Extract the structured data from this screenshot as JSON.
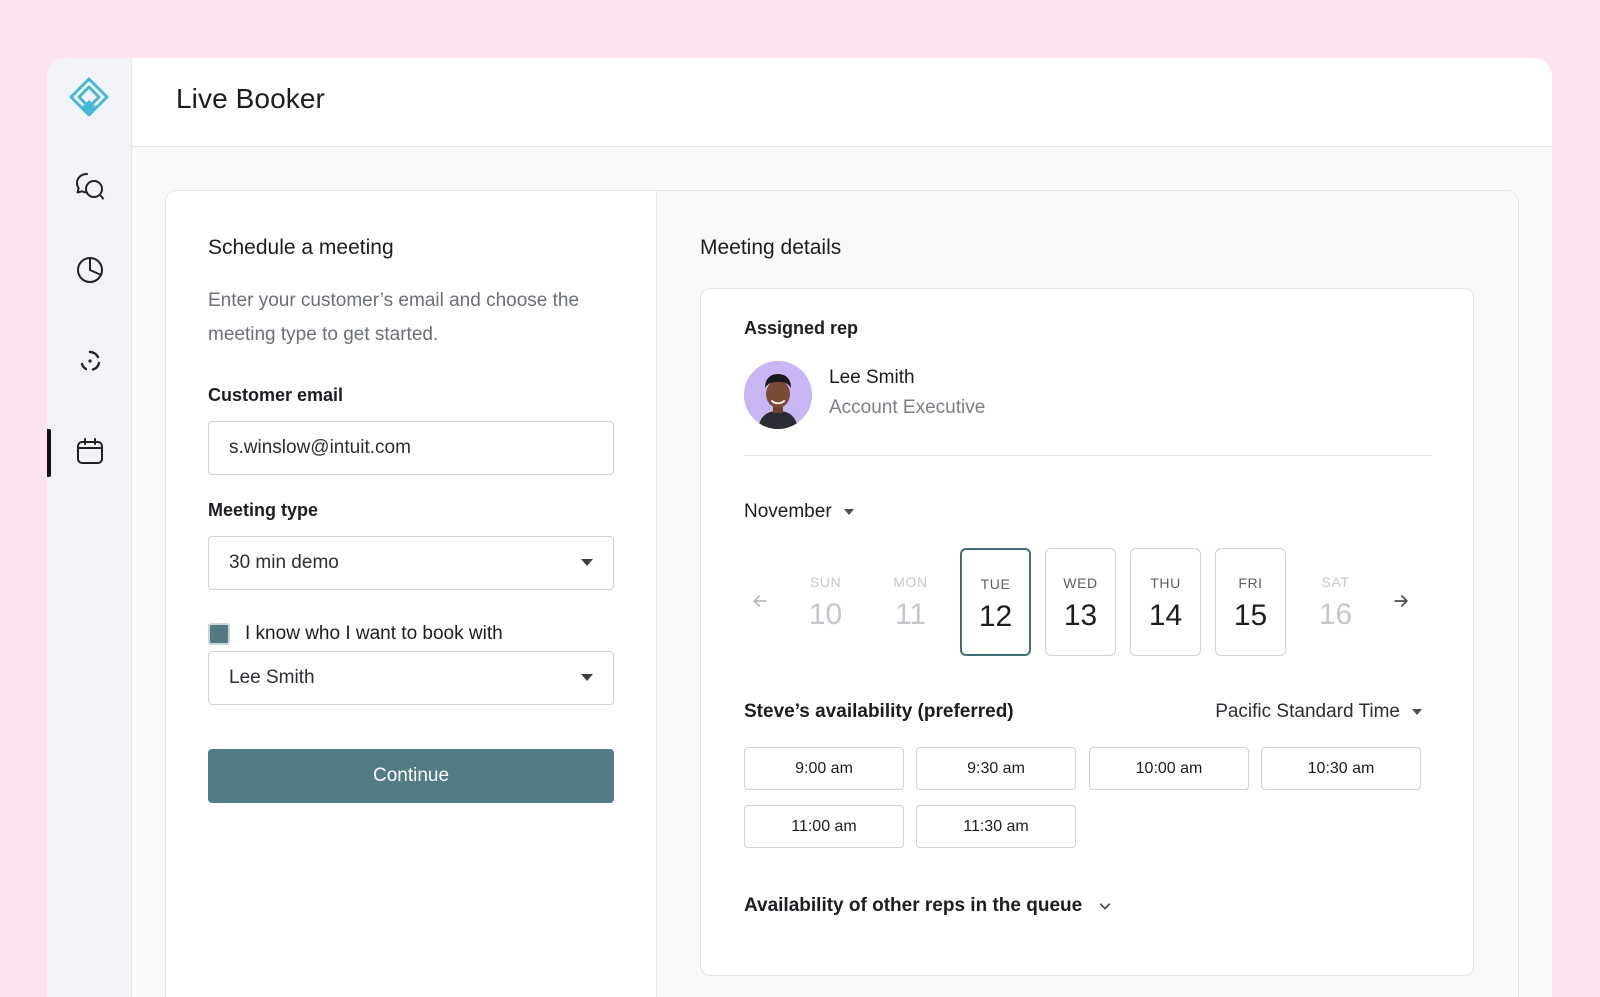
{
  "app": {
    "title": "Live Booker"
  },
  "rail": {
    "logo": "diamond-logo-icon",
    "items": [
      {
        "icon": "chat-bubbles-icon"
      },
      {
        "icon": "pie-chart-icon"
      },
      {
        "icon": "loading-dots-icon"
      },
      {
        "icon": "calendar-icon",
        "active": true
      }
    ]
  },
  "schedule": {
    "title": "Schedule a meeting",
    "description": "Enter your customer’s email and choose the meeting type to get started.",
    "email_label": "Customer email",
    "email_value": "s.winslow@intuit.com",
    "type_label": "Meeting type",
    "type_value": "30 min demo",
    "checkbox_label": "I know who I want to book with",
    "checkbox_checked": true,
    "rep_value": "Lee Smith",
    "continue_label": "Continue"
  },
  "details": {
    "title": "Meeting details",
    "assigned_label": "Assigned rep",
    "rep": {
      "name": "Lee Smith",
      "title": "Account Executive"
    },
    "month": "November",
    "days": [
      {
        "name": "SUN",
        "date": "10",
        "state": "disabled"
      },
      {
        "name": "MON",
        "date": "11",
        "state": "disabled"
      },
      {
        "name": "TUE",
        "date": "12",
        "state": "selected"
      },
      {
        "name": "WED",
        "date": "13",
        "state": "available"
      },
      {
        "name": "THU",
        "date": "14",
        "state": "available"
      },
      {
        "name": "FRI",
        "date": "15",
        "state": "available"
      },
      {
        "name": "SAT",
        "date": "16",
        "state": "disabled"
      }
    ],
    "availability_label": "Steve’s availability (preferred)",
    "timezone": "Pacific Standard Time",
    "slots": [
      "9:00 am",
      "9:30 am",
      "10:00 am",
      "10:30 am",
      "11:00 am",
      "11:30 am"
    ],
    "others_label": "Availability of other reps in the queue"
  },
  "colors": {
    "background": "#fde3ef",
    "primary_button": "#527b82",
    "selected_day_border": "#3e6f77",
    "avatar_bg": "#c9b7f3",
    "logo": "#45b8d6"
  }
}
